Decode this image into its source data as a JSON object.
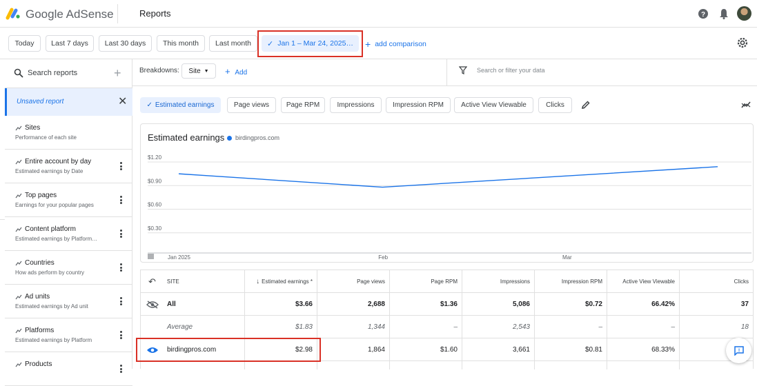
{
  "app": {
    "brand": "Google AdSense",
    "page_title": "Reports"
  },
  "date_ranges": [
    {
      "label": "Today"
    },
    {
      "label": "Last 7 days"
    },
    {
      "label": "Last 30 days"
    },
    {
      "label": "This month"
    },
    {
      "label": "Last month"
    },
    {
      "label": "Jan 1 – Mar 24, 2025…",
      "selected": true
    }
  ],
  "add_comparison": "add comparison",
  "sidebar": {
    "search_placeholder": "Search reports",
    "unsaved": "Unsaved report",
    "items": [
      {
        "title": "Sites",
        "subtitle": "Performance of each site",
        "menu": false
      },
      {
        "title": "Entire account by day",
        "subtitle": "Estimated earnings by Date",
        "menu": true
      },
      {
        "title": "Top pages",
        "subtitle": "Earnings for your popular pages",
        "menu": true
      },
      {
        "title": "Content platform",
        "subtitle": "Estimated earnings by Platform…",
        "menu": true
      },
      {
        "title": "Countries",
        "subtitle": "How ads perform by country",
        "menu": true
      },
      {
        "title": "Ad units",
        "subtitle": "Estimated earnings by Ad unit",
        "menu": true
      },
      {
        "title": "Platforms",
        "subtitle": "Estimated earnings by Platform",
        "menu": true
      },
      {
        "title": "Products",
        "subtitle": "",
        "menu": true
      }
    ]
  },
  "toolbar": {
    "breakdowns_label": "Breakdowns:",
    "breakdown_value": "Site",
    "add_label": "Add",
    "filter_placeholder": "Search or filter your data"
  },
  "metrics": [
    {
      "label": "Estimated earnings",
      "selected": true
    },
    {
      "label": "Page views"
    },
    {
      "label": "Page RPM"
    },
    {
      "label": "Impressions"
    },
    {
      "label": "Impression RPM"
    },
    {
      "label": "Active View Viewable"
    },
    {
      "label": "Clicks"
    }
  ],
  "chart_data": {
    "type": "line",
    "title": "Estimated earnings",
    "series": [
      {
        "name": "birdingpros.com",
        "color": "#1a73e8",
        "points": [
          {
            "x": "2025-01-01",
            "y": 1.05
          },
          {
            "x": "2025-02-01",
            "y": 0.88
          },
          {
            "x": "2025-03-24",
            "y": 1.14
          }
        ]
      }
    ],
    "x_ticks": [
      "Jan 2025",
      "Feb",
      "Mar"
    ],
    "y_ticks": [
      "$1.20",
      "$0.90",
      "$0.60",
      "$0.30"
    ],
    "ylim": [
      0,
      1.2
    ],
    "xlim": [
      "2025-01-01",
      "2025-03-24"
    ],
    "grid": true
  },
  "table": {
    "headers": [
      "SITE",
      "Estimated earnings *",
      "Page views",
      "Page RPM",
      "Impressions",
      "Impression RPM",
      "Active View Viewable",
      "Clicks"
    ],
    "rows": [
      {
        "kind": "all",
        "cells": [
          "All",
          "$3.66",
          "2,688",
          "$1.36",
          "5,086",
          "$0.72",
          "66.42%",
          "37"
        ]
      },
      {
        "kind": "avg",
        "cells": [
          "Average",
          "$1.83",
          "1,344",
          "–",
          "2,543",
          "–",
          "–",
          "18"
        ]
      },
      {
        "kind": "site",
        "cells": [
          "birdingpros.com",
          "$2.98",
          "1,864",
          "$1.60",
          "3,661",
          "$0.81",
          "68.33%",
          ""
        ]
      }
    ]
  },
  "colors": {
    "accent": "#1a73e8",
    "highlight": "#d93025"
  }
}
